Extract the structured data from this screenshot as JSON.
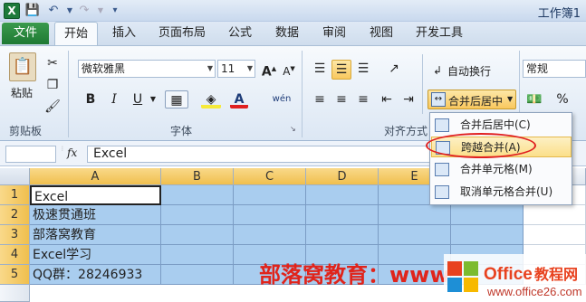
{
  "titlebar": {
    "title": "工作簿1"
  },
  "tabs": {
    "file": "文件",
    "items": [
      "开始",
      "插入",
      "页面布局",
      "公式",
      "数据",
      "审阅",
      "视图",
      "开发工具"
    ]
  },
  "ribbon": {
    "clipboard": {
      "paste": "粘贴",
      "label": "剪贴板"
    },
    "font": {
      "name": "微软雅黑",
      "size": "11",
      "grow": "A",
      "shrink": "A",
      "bold": "B",
      "italic": "I",
      "underline": "U",
      "font_color": "A",
      "phonetic": "wén",
      "label": "字体"
    },
    "alignment": {
      "wrap": "自动换行",
      "merge_center": "合并后居中",
      "label": "对齐方式"
    },
    "number": {
      "format": "常规",
      "percent": "%"
    }
  },
  "formula_bar": {
    "fx": "fx",
    "content": "Excel"
  },
  "grid": {
    "columns": [
      "A",
      "B",
      "C",
      "D",
      "E"
    ],
    "rows": [
      "1",
      "2",
      "3",
      "4",
      "5"
    ],
    "a_cells": [
      "Excel",
      "极速贯通班",
      "部落窝教育",
      "Excel学习",
      "QQ群：28246933"
    ]
  },
  "merge_menu": {
    "items": [
      "合并后居中(C)",
      "跨越合并(A)",
      "合并单元格(M)",
      "取消单元格合并(U)"
    ],
    "selected_index": 1
  },
  "watermark": {
    "text": "部落窝教育：www",
    "logo_main": "Office教程网",
    "logo_sub": "www.office26.com"
  },
  "colors": {
    "selection": "#a9cdef",
    "accent_green": "#1e7a33",
    "highlight_oval": "#e02020"
  }
}
